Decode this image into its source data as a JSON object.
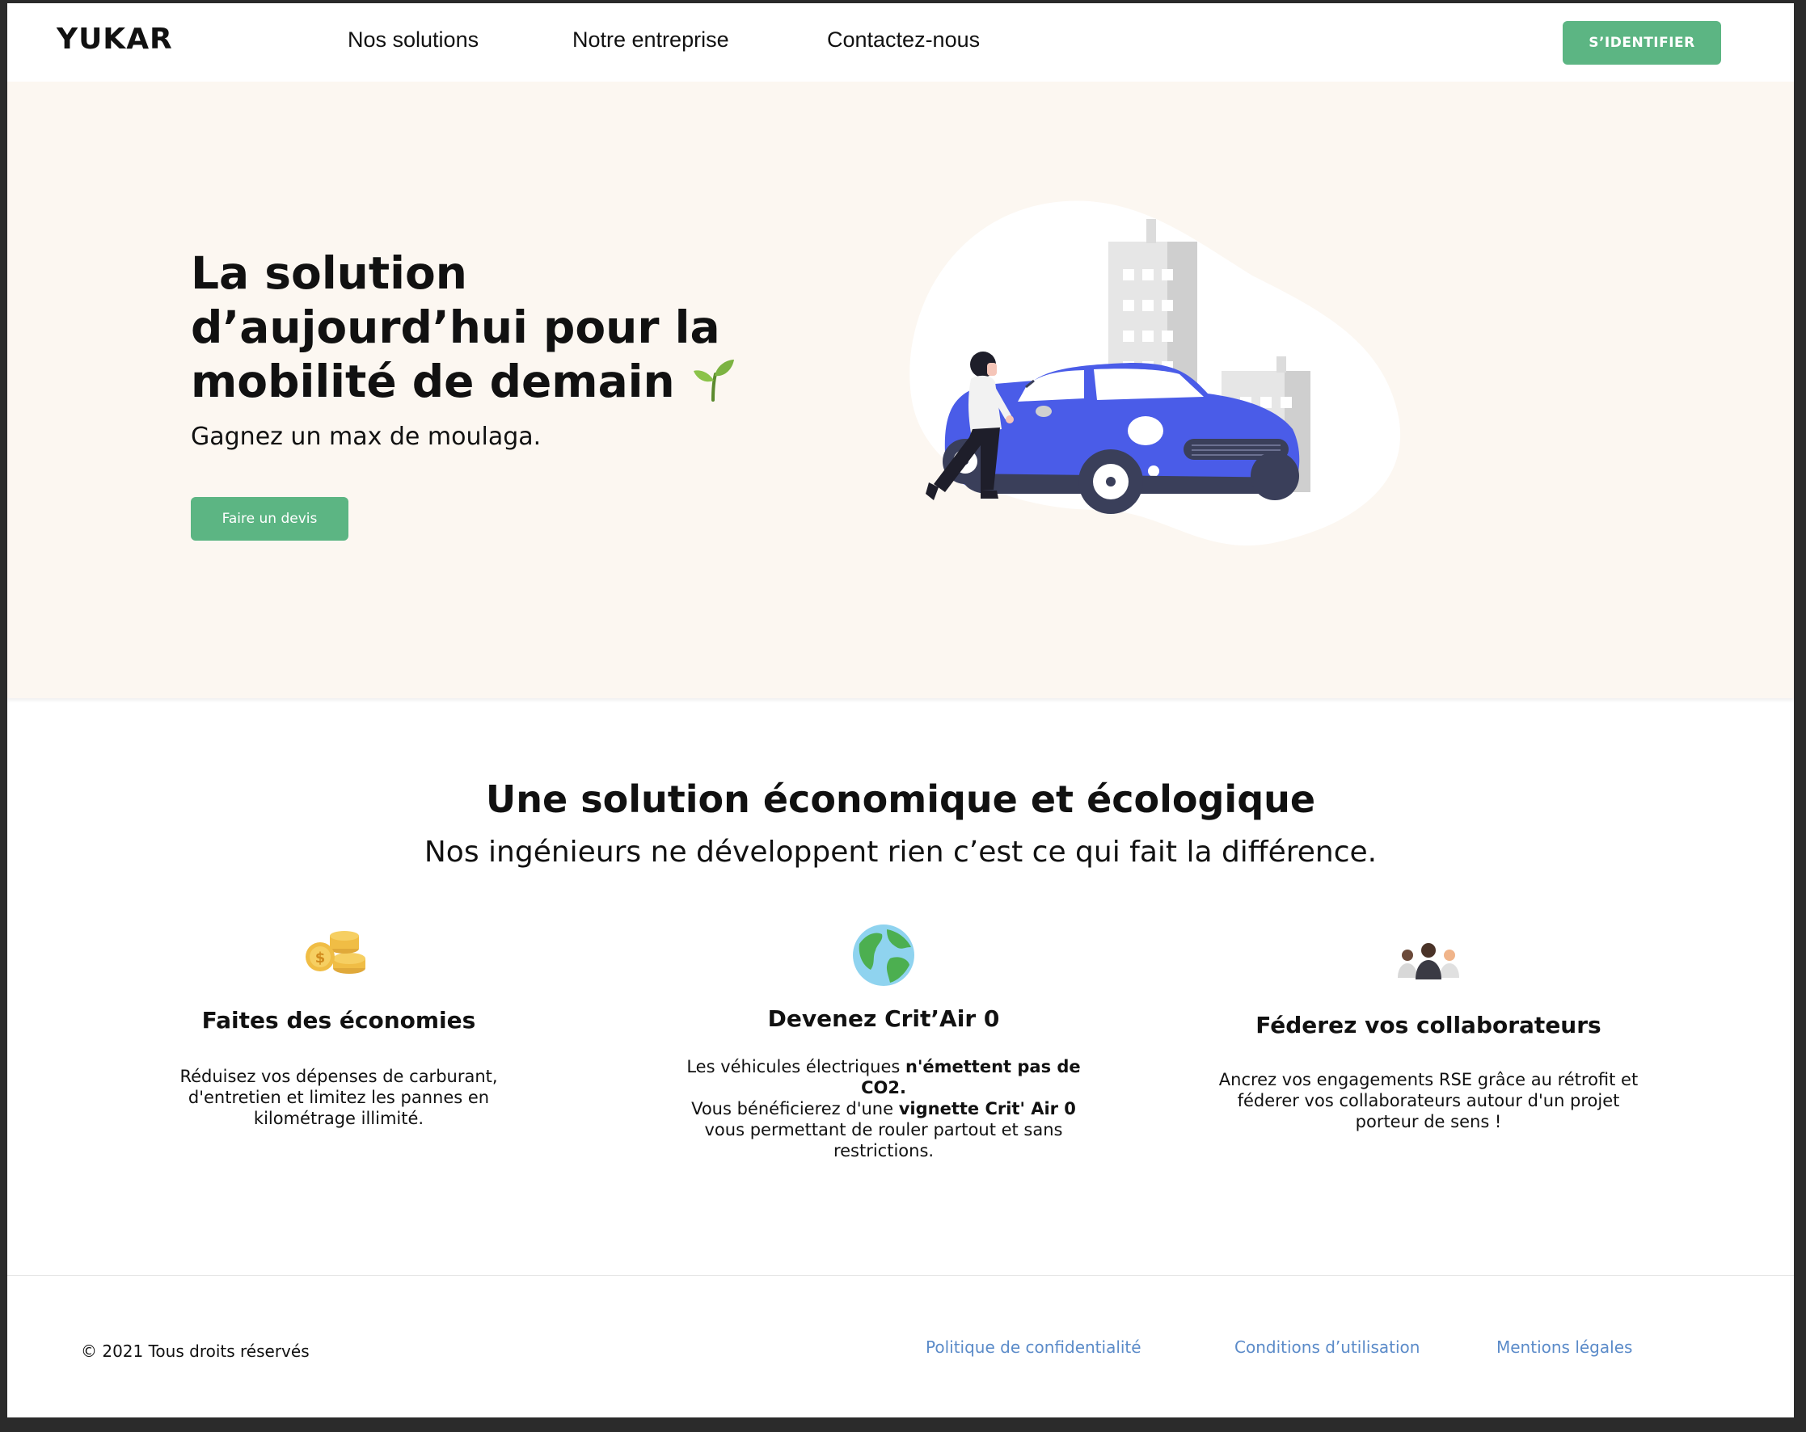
{
  "header": {
    "logo": "YUKAR",
    "nav": [
      "Nos solutions",
      "Notre entreprise",
      "Contactez-nous"
    ],
    "login_label": "S’IDENTIFIER"
  },
  "hero": {
    "title": "La solution d’aujourd’hui pour la mobilité de demain",
    "title_icon": "seedling-icon",
    "subtitle": "Gagnez un max de moulaga.",
    "cta_label": "Faire un devis",
    "illustration": "woman-with-blue-car-and-buildings"
  },
  "features": {
    "title": "Une solution économique et écologique",
    "subtitle": "Nos ingénieurs ne développent rien c’est ce qui fait la différence.",
    "items": [
      {
        "icon": "coins-icon",
        "title": "Faites des économies",
        "text": "Réduisez vos dépenses de carburant, d'entretien et limitez les pannes en kilométrage illimité."
      },
      {
        "icon": "globe-icon",
        "title": "Devenez Crit’Air 0",
        "text_before": "Les véhicules électriques ",
        "text_bold1": "n'émettent pas de CO2.",
        "text_mid": "Vous bénéficierez d'une ",
        "text_bold2": "vignette Crit' Air 0",
        "text_after": " vous permettant de rouler partout et sans restrictions."
      },
      {
        "icon": "people-icon",
        "title": "Féderez vos collaborateurs",
        "text": "Ancrez vos engagements RSE grâce au rétrofit et féderer vos collaborateurs autour d'un projet porteur de sens !"
      }
    ]
  },
  "footer": {
    "copyright": "© 2021 Tous droits réservés",
    "links": [
      "Politique de confidentialité",
      "Conditions d’utilisation",
      "Mentions légales"
    ]
  },
  "colors": {
    "accent_green": "#5cb583",
    "hero_background": "#fcf7f1",
    "car_blue": "#4a5ce8",
    "footer_link": "#5b8bc9"
  }
}
